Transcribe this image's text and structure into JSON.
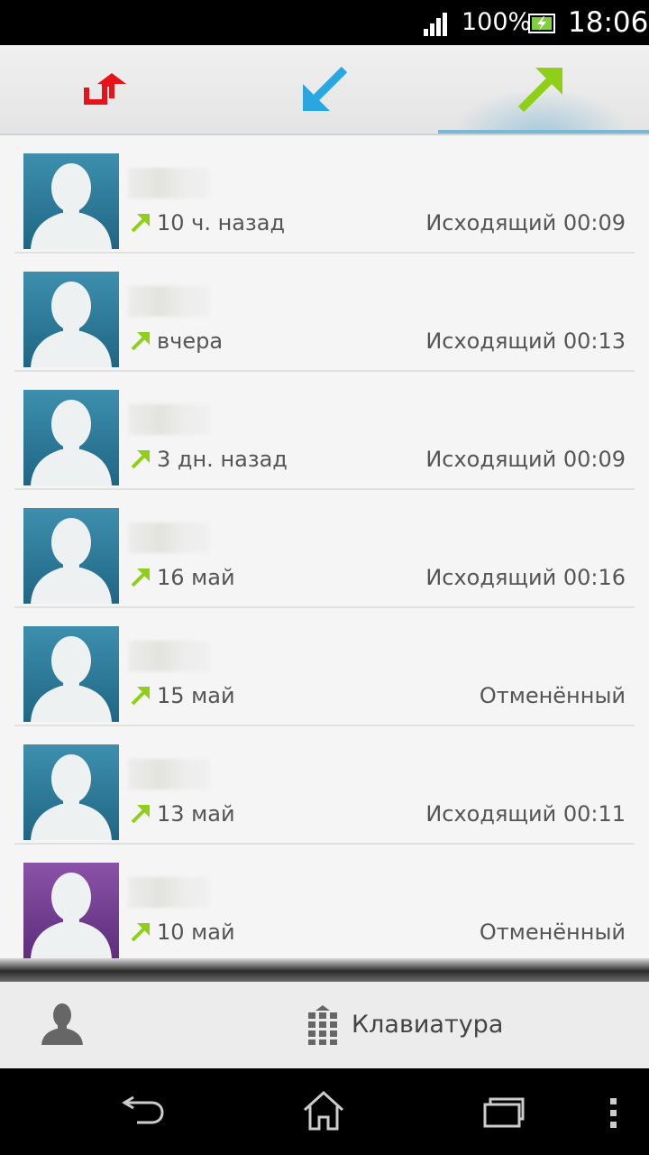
{
  "status_bar": {
    "battery_percent": "100%",
    "time": "18:06"
  },
  "tabs": [
    {
      "name": "missed",
      "icon": "missed-call-icon",
      "color": "#e8121b"
    },
    {
      "name": "received",
      "icon": "incoming-call-icon",
      "color": "#2aa7e0"
    },
    {
      "name": "outgoing",
      "icon": "outgoing-call-icon",
      "color": "#8fcf1a",
      "selected": true
    }
  ],
  "calls": [
    {
      "when": "10 ч. назад",
      "status": "Исходящий 00:09",
      "avatar_color": "#2d7a98",
      "direction": "outgoing"
    },
    {
      "when": "вчера",
      "status": "Исходящий 00:13",
      "avatar_color": "#2d7a98",
      "direction": "outgoing"
    },
    {
      "when": "3 дн. назад",
      "status": "Исходящий 00:09",
      "avatar_color": "#2d7a98",
      "direction": "outgoing"
    },
    {
      "when": "16 май",
      "status": "Исходящий 00:16",
      "avatar_color": "#2d7a98",
      "direction": "outgoing"
    },
    {
      "when": "15 май",
      "status": "Отменённый",
      "avatar_color": "#2d7a98",
      "direction": "outgoing"
    },
    {
      "when": "13 май",
      "status": "Исходящий 00:11",
      "avatar_color": "#2d7a98",
      "direction": "outgoing"
    },
    {
      "when": "10 май",
      "status": "Отменённый",
      "avatar_color": "#7a3f98",
      "direction": "outgoing"
    }
  ],
  "action_bar": {
    "contacts_icon": "person-icon",
    "keypad_icon": "keypad-grid-icon",
    "keypad_label": "Клавиатура"
  },
  "nav_bar": {
    "back_icon": "back-icon",
    "home_icon": "home-icon",
    "recent_icon": "recent-apps-icon",
    "menu_icon": "overflow-menu-icon"
  }
}
